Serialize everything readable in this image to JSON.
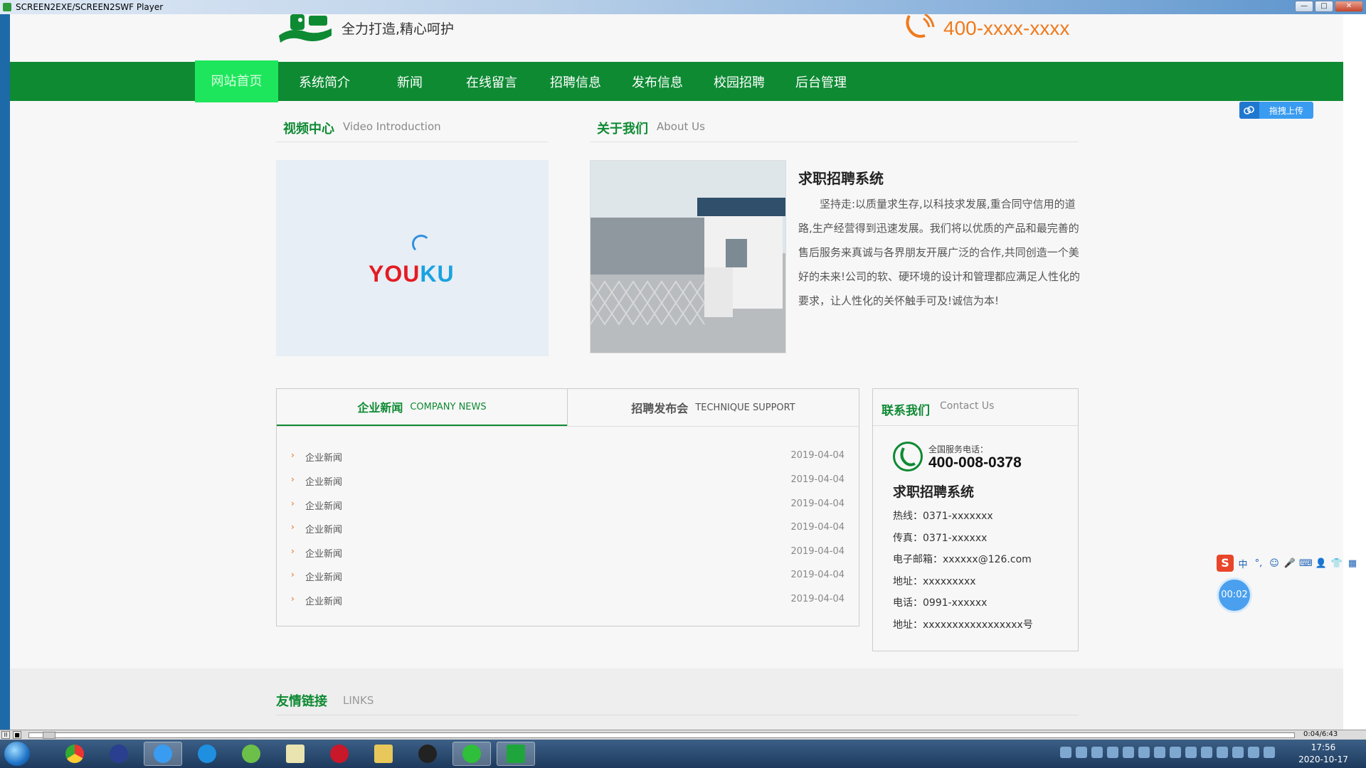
{
  "window": {
    "title": "SCREEN2EXE/SCREEN2SWF Player",
    "buttons": {
      "minimize": "—",
      "maximize": "□",
      "close": "✕"
    }
  },
  "header": {
    "slogan": "全力打造,精心呵护",
    "phone": "400-xxxx-xxxx"
  },
  "nav": {
    "items": [
      {
        "label": "网站首页",
        "active": true
      },
      {
        "label": "系统简介"
      },
      {
        "label": "新闻"
      },
      {
        "label": "在线留言"
      },
      {
        "label": "招聘信息"
      },
      {
        "label": "发布信息"
      },
      {
        "label": "校园招聘"
      },
      {
        "label": "后台管理"
      }
    ]
  },
  "upload": {
    "label": "拖拽上传"
  },
  "video": {
    "title": "视频中心",
    "subtitle": "Video Introduction",
    "logo": "YOUKU"
  },
  "about": {
    "title": "关于我们",
    "subtitle": "About Us",
    "heading": "求职招聘系统",
    "text": "坚持走:以质量求生存,以科技求发展,重合同守信用的道路,生产经营得到迅速发展。我们将以优质的产品和最完善的售后服务来真诚与各界朋友开展广泛的合作,共同创造一个美好的未来!公司的软、硬环境的设计和管理都应满足人性化的要求，让人性化的关怀触手可及!诚信为本!"
  },
  "news": {
    "tabs": [
      {
        "cn": "企业新闻",
        "en": "COMPANY NEWS",
        "active": true
      },
      {
        "cn": "招聘发布会",
        "en": "TECHNIQUE SUPPORT",
        "active": false
      }
    ],
    "rows": [
      {
        "title": "企业新闻",
        "date": "2019-04-04"
      },
      {
        "title": "企业新闻",
        "date": "2019-04-04"
      },
      {
        "title": "企业新闻",
        "date": "2019-04-04"
      },
      {
        "title": "企业新闻",
        "date": "2019-04-04"
      },
      {
        "title": "企业新闻",
        "date": "2019-04-04"
      },
      {
        "title": "企业新闻",
        "date": "2019-04-04"
      },
      {
        "title": "企业新闻",
        "date": "2019-04-04"
      }
    ]
  },
  "contact": {
    "title": "联系我们",
    "subtitle": "Contact Us",
    "hotline_label": "全国服务电话：",
    "hotline": "400-008-0378",
    "company": "求职招聘系统",
    "lines": [
      "热线：0371-xxxxxxx",
      "传真：0371-xxxxxx",
      "电子邮箱：xxxxxx@126.com",
      "地址：xxxxxxxxx",
      "电话：0991-xxxxxx",
      "地址：xxxxxxxxxxxxxxxxx号"
    ]
  },
  "links": {
    "title": "友情链接",
    "subtitle": "LINKS"
  },
  "ime": {
    "logo": "S",
    "mode": "中",
    "punct": "°,",
    "emoji": "☺",
    "mic": "🎤",
    "keyboard": "⌨",
    "user": "👤",
    "skin": "👕",
    "menu": "▦"
  },
  "timer": "00:02",
  "player": {
    "time": "0:04/6:43",
    "pause": "II",
    "stop": "■"
  },
  "clock": {
    "time": "17:56",
    "date": "2020-10-17"
  },
  "colors": {
    "brand_green": "#0e8a33",
    "active_nav": "#1ee65c",
    "phone_orange": "#f07a1c",
    "youku_red": "#e41b23",
    "youku_blue": "#1aa2e0"
  }
}
